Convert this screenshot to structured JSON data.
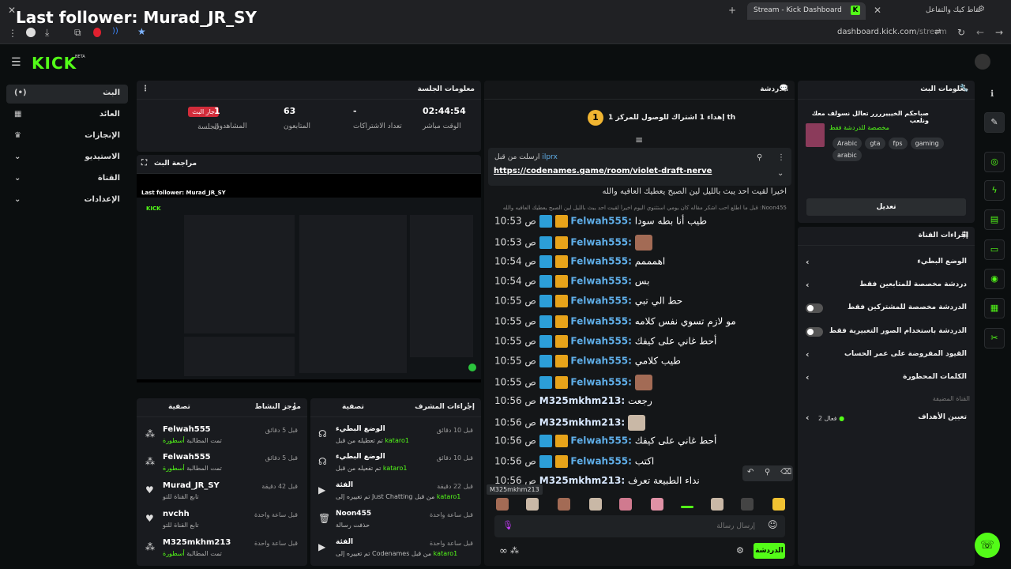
{
  "overlay": {
    "title": "Last follower: Murad_JR_SY"
  },
  "browser": {
    "tab_title": "Stream - Kick Dashboard",
    "tab_favicon": "K",
    "other_tab": "نقاط كيك والتفاعل",
    "url_host": "dashboard.kick.com",
    "url_path": "/stream"
  },
  "kick": {
    "logo": "KICK",
    "beta": "BETA"
  },
  "nav": [
    {
      "label": "البث",
      "icon": "(•)"
    },
    {
      "label": "العائد",
      "icon": "▦"
    },
    {
      "label": "الإنجازات",
      "icon": "🏆"
    },
    {
      "label": "الاستيديو",
      "icon": "⌄"
    },
    {
      "label": "القناة",
      "icon": "⌄"
    },
    {
      "label": "الإعدادات",
      "icon": "⌄"
    }
  ],
  "session": {
    "title": "معلومات الجلسة",
    "live_badge": "جار البث",
    "live_label": "الجلسة",
    "viewers": "1",
    "viewers_label": "المشاهدون",
    "followers": "63",
    "followers_label": "المتابعون",
    "subs": "-",
    "subs_label": "تعداد الاشتراكات",
    "uptime": "02:44:54",
    "uptime_label": "الوقت مباشر"
  },
  "preview": {
    "title": "مراجعة البث",
    "overlay": "Last follower: Murad_JR_SY"
  },
  "activity": {
    "title": "موجز النشاط",
    "filter": "تصفية",
    "items": [
      {
        "name": "Felwah555",
        "sub": "تمت المطالبة",
        "sub_hl": "أسطورة",
        "time": "قبل 5 دقائق"
      },
      {
        "name": "Felwah555",
        "sub": "تمت المطالبة",
        "sub_hl": "أسطورة",
        "time": "قبل 5 دقائق"
      },
      {
        "name": "Murad_JR_SY",
        "sub": "تابع القناة للتو",
        "sub_hl": "",
        "time": "قبل 42 دقيقة"
      },
      {
        "name": "nvchh",
        "sub": "تابع القناة للتو",
        "sub_hl": "",
        "time": "قبل ساعة واحدة"
      },
      {
        "name": "M325mkhm213",
        "sub": "تمت المطالبة",
        "sub_hl": "أسطورة",
        "time": "قبل ساعة واحدة"
      }
    ]
  },
  "modactions": {
    "title": "إجراءات المشرف",
    "filter": "تصفية",
    "items": [
      {
        "name": "الوضع البطيء",
        "sub": "تم تعطيله من قبل",
        "user": "kataro1",
        "time": "قبل 10 دقائق"
      },
      {
        "name": "الوضع البطيء",
        "sub": "تم تفعيله من قبل",
        "user": "kataro1",
        "time": "قبل 10 دقائق"
      },
      {
        "name": "الفئة",
        "sub": "تم تغييره إلى Just Chatting من قبل",
        "user": "kataro1",
        "time": "قبل 22 دقيقة"
      },
      {
        "name": "Noon455",
        "sub": "حذفت رسالة",
        "user": "",
        "time": "قبل ساعة واحدة"
      },
      {
        "name": "الفئة",
        "sub": "تم تغييره إلى Codenames من قبل",
        "user": "kataro1",
        "time": "قبل ساعة واحدة"
      }
    ]
  },
  "chat": {
    "title": "الدردشة",
    "goal_num": "1",
    "goal_text": "إهداء 1 اشتراك للوصول للمركز 1 th",
    "pinned_by": "ارسلت من قبل",
    "pinned_user": "ilprx",
    "pinned_link": "https://codenames.game/room/violet-draft-nerve",
    "prev_msg": "اخيراً لقيت احد يبث بالليل لين الصبح يعطيك العافيه والله",
    "reply_hint": "Noon455: قبل ما اطلع احب اشكر مقاله كان يومي استثنوي اليوم اخيراً لقيت احد يبث بالليل لين الصبح يعطيك العافيه والله",
    "messages": [
      {
        "time": "10:53 ص",
        "user": "Felwah555",
        "text": "طيب أنا بطه سودا",
        "emote": "",
        "type": "f"
      },
      {
        "time": "10:53 ص",
        "user": "Felwah555",
        "text": "",
        "emote": "face",
        "type": "f"
      },
      {
        "time": "10:54 ص",
        "user": "Felwah555",
        "text": "اهمممم",
        "emote": "",
        "type": "f"
      },
      {
        "time": "10:54 ص",
        "user": "Felwah555",
        "text": "بس",
        "emote": "",
        "type": "f"
      },
      {
        "time": "10:55 ص",
        "user": "Felwah555",
        "text": "حط الي تبي",
        "emote": "",
        "type": "f"
      },
      {
        "time": "10:55 ص",
        "user": "Felwah555",
        "text": "مو لازم تسوي نفس كلامه",
        "emote": "",
        "type": "f"
      },
      {
        "time": "10:55 ص",
        "user": "Felwah555",
        "text": "أحط غاني على كيفك",
        "emote": "",
        "type": "f"
      },
      {
        "time": "10:55 ص",
        "user": "Felwah555",
        "text": "طيب كلامي",
        "emote": "",
        "type": "f"
      },
      {
        "time": "10:55 ص",
        "user": "Felwah555",
        "text": "",
        "emote": "face",
        "type": "f"
      },
      {
        "time": "10:56 ص",
        "user": "M325mkhm213",
        "text": "رجعت",
        "emote": "",
        "type": "m"
      },
      {
        "time": "10:56 ص",
        "user": "M325mkhm213",
        "text": "",
        "emote": "cat",
        "type": "m"
      },
      {
        "time": "10:56 ص",
        "user": "Felwah555",
        "text": "أحط غاني على كيفك",
        "emote": "",
        "type": "f"
      },
      {
        "time": "10:56 ص",
        "user": "Felwah555",
        "text": "اكتب",
        "emote": "",
        "type": "f"
      },
      {
        "time": "10:56 ص",
        "user": "M325mkhm213",
        "text": "نداء الطبيعة تعرف",
        "emote": "",
        "type": "m"
      }
    ],
    "tooltip": "M325mkhm213",
    "input_placeholder": "إرسال رسالة",
    "send": "الدردشة"
  },
  "streaminfo": {
    "title": "معلومات البث",
    "stream_title": "صباحكم الخيييرررر تعالل نسولف معك ونلعب",
    "category": "مخصصة للدردشة فقط",
    "tags": [
      "Arabic",
      "gta",
      "fps",
      "gaming",
      "arabic"
    ],
    "edit": "تعديل"
  },
  "channelactions": {
    "title": "إجراءات القناة",
    "rows": [
      {
        "label": "الوضع البطيء",
        "kind": "arrow"
      },
      {
        "label": "دردشة مخصصة للمتابعين فقط",
        "kind": "arrow"
      },
      {
        "label": "الدردشة مخصصة للمشتركين فقط",
        "kind": "toggle"
      },
      {
        "label": "الدردشة باستخدام الصور التعبيرية فقط",
        "kind": "toggle"
      },
      {
        "label": "القيود المفروضة على عمر الحساب",
        "kind": "arrow"
      },
      {
        "label": "الكلمات المحظورة",
        "kind": "arrow"
      }
    ],
    "section": "القناة المضيفة",
    "goals": "تعيين الأهداف",
    "goals_status": "فعال 2"
  }
}
